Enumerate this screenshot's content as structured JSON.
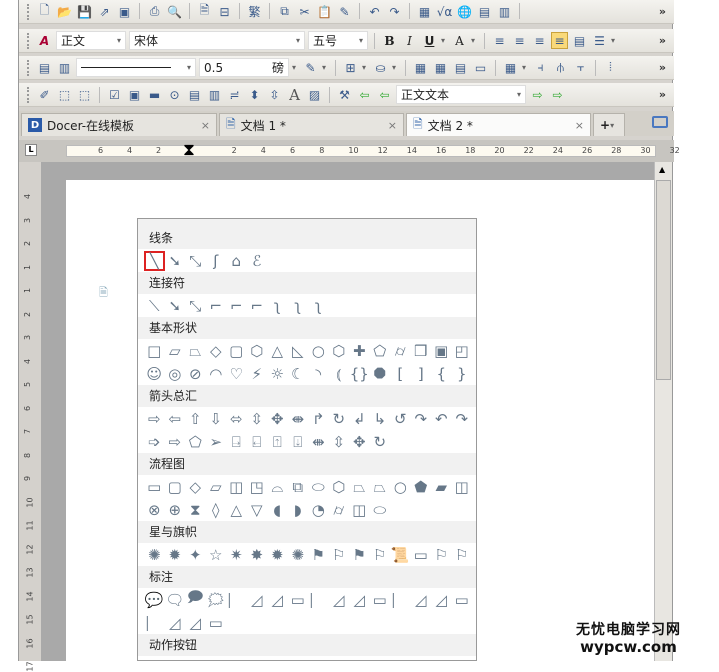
{
  "toolbar1": {
    "icons": [
      [
        "new-doc-icon",
        "🗋"
      ],
      [
        "open-icon",
        "📂"
      ],
      [
        "save-icon",
        "💾"
      ],
      [
        "export-icon",
        "⇗"
      ],
      [
        "pdf-icon",
        "▣"
      ],
      [
        "print-icon",
        "⎙"
      ],
      [
        "print-preview-icon",
        "🔍"
      ],
      [
        "page-setup-icon",
        "🗎"
      ],
      [
        "split-icon",
        "⊟"
      ],
      [
        "traditional-chinese-icon",
        "繁"
      ],
      [
        "copy-icon",
        "⧉"
      ],
      [
        "cut-icon",
        "✂"
      ],
      [
        "paste-icon",
        "📋"
      ],
      [
        "format-painter-icon",
        "✎"
      ],
      [
        "undo-icon",
        "↶"
      ],
      [
        "redo-icon",
        "↷"
      ],
      [
        "table-icon",
        "▦"
      ],
      [
        "formula-icon",
        "√α"
      ],
      [
        "hyperlink-icon",
        "🌐"
      ],
      [
        "grid-icon",
        "▤"
      ],
      [
        "columns-icon",
        "▥"
      ]
    ]
  },
  "toolbar2": {
    "style": "正文",
    "font": "宋体",
    "size": "五号",
    "bold": "B",
    "italic": "I",
    "underline": "U",
    "fontcolor": "A"
  },
  "toolbar3": {
    "line_width": "0.5",
    "unit": "磅"
  },
  "toolbar4": {
    "style": "正文文本",
    "text_icon": "A"
  },
  "more": "»",
  "tabs": [
    {
      "label": "Docer-在线模板"
    },
    {
      "label": "文档 1 *"
    },
    {
      "label": "文档 2 *"
    }
  ],
  "tab_close": "×",
  "new_tab": "+",
  "ruler": [
    "6",
    "4",
    "2",
    "2",
    "4",
    "6",
    "8",
    "10",
    "12",
    "14",
    "16",
    "18",
    "20",
    "22",
    "24",
    "26",
    "28",
    "30",
    "32"
  ],
  "vruler": [
    "4",
    "3",
    "2",
    "1",
    "1",
    "2",
    "3",
    "4",
    "5",
    "6",
    "7",
    "8",
    "9",
    "10",
    "11",
    "12",
    "13",
    "14",
    "15",
    "16",
    "17"
  ],
  "panel": {
    "sections": [
      {
        "title": "线条",
        "rows": [
          [
            "╲",
            "➘",
            "⤡",
            "ʃ",
            "⌂",
            "ℰ"
          ]
        ]
      },
      {
        "title": "连接符",
        "rows": [
          [
            "⟍",
            "➘",
            "⤡",
            "⌐",
            "⌐",
            "⌐",
            "ʅ",
            "ʅ",
            "ʅ"
          ]
        ]
      },
      {
        "title": "基本形状",
        "rows": [
          [
            "□",
            "▱",
            "⏢",
            "◇",
            "▢",
            "⬡",
            "△",
            "◺",
            "○",
            "⬡",
            "✚",
            "⬠",
            "⌭",
            "❒",
            "▣",
            "◰"
          ],
          [
            "☺",
            "◎",
            "⊘",
            "◠",
            "♡",
            "⚡",
            "☼",
            "☾",
            "◝",
            "⦅",
            "{}",
            "⯃",
            "[",
            "]",
            "{",
            "}"
          ]
        ]
      },
      {
        "title": "箭头总汇",
        "rows": [
          [
            "⇨",
            "⇦",
            "⇧",
            "⇩",
            "⬄",
            "⇳",
            "✥",
            "⇼",
            "↱",
            "↻",
            "↲",
            "↳",
            "↺",
            "↷",
            "↶",
            "↷"
          ],
          [
            "➩",
            "⇨",
            "⬠",
            "➢",
            "⍈",
            "⍇",
            "⍐",
            "⍗",
            "⇼",
            "⇳",
            "✥",
            "↻"
          ]
        ]
      },
      {
        "title": "流程图",
        "rows": [
          [
            "▭",
            "▢",
            "◇",
            "▱",
            "◫",
            "◳",
            "⌓",
            "⧉",
            "⬭",
            "⬡",
            "⏢",
            "⏢",
            "○",
            "⬟",
            "▰",
            "◫"
          ],
          [
            "⊗",
            "⊕",
            "⧗",
            "◊",
            "△",
            "▽",
            "◖",
            "◗",
            "◔",
            "⌭",
            "◫",
            "⬭"
          ]
        ]
      },
      {
        "title": "星与旗帜",
        "rows": [
          [
            "✺",
            "✹",
            "✦",
            "☆",
            "✷",
            "✸",
            "✹",
            "✺",
            "⚑",
            "⚐",
            "⚑",
            "⚐",
            "📜",
            "▭",
            "⚐",
            "⚐"
          ]
        ]
      },
      {
        "title": "标注",
        "rows": [
          [
            "💬",
            "🗨",
            "🗩",
            "🗯",
            "⎸",
            "◿",
            "◿",
            "▭",
            "⎸",
            "◿",
            "◿",
            "▭",
            "⎸",
            "◿",
            "◿",
            "▭"
          ],
          [
            "⎸",
            "◿",
            "◿",
            "▭"
          ]
        ]
      },
      {
        "title": "动作按钮",
        "rows": []
      }
    ]
  },
  "watermark": {
    "line1": "无忧电脑学习网",
    "line2": "wypcw.com"
  }
}
